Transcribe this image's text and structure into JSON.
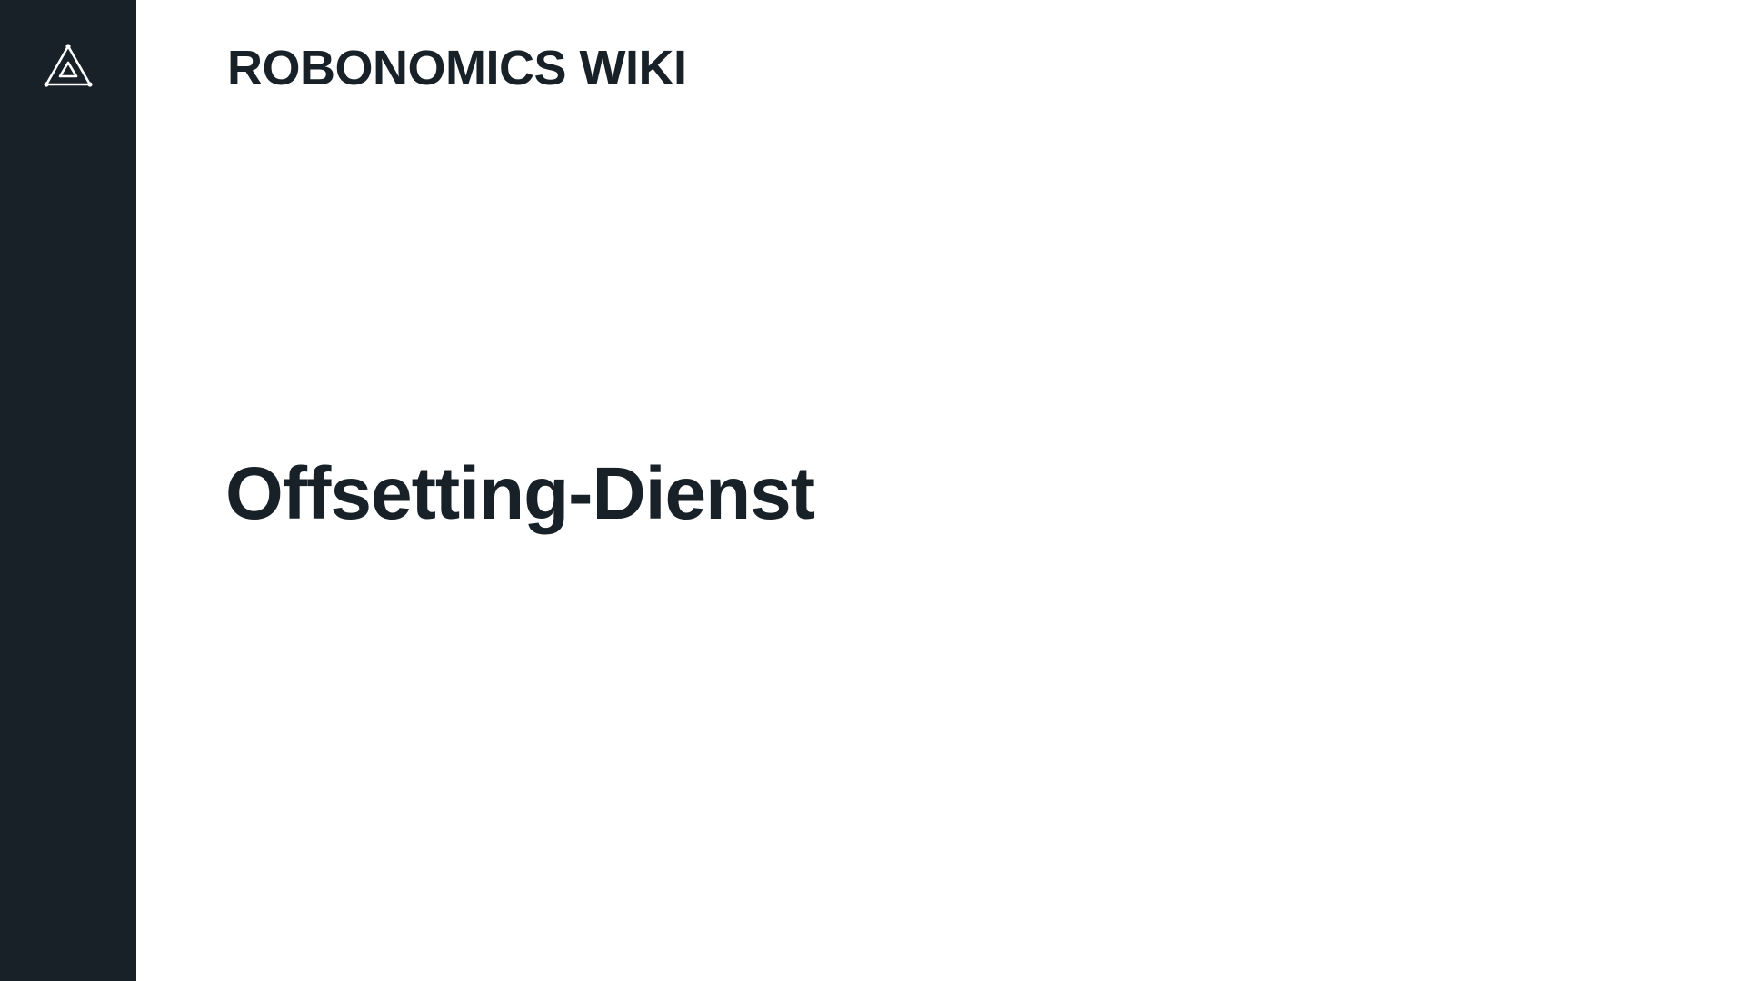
{
  "sidebar": {
    "logo_icon": "robonomics-triangle-icon",
    "background_color": "#182127",
    "icon_color": "#ffffff"
  },
  "header": {
    "site_title": "ROBONOMICS WIKI"
  },
  "main": {
    "heading": "Offsetting-Dienst"
  },
  "colors": {
    "text": "#182127",
    "page_background": "#ffffff"
  }
}
